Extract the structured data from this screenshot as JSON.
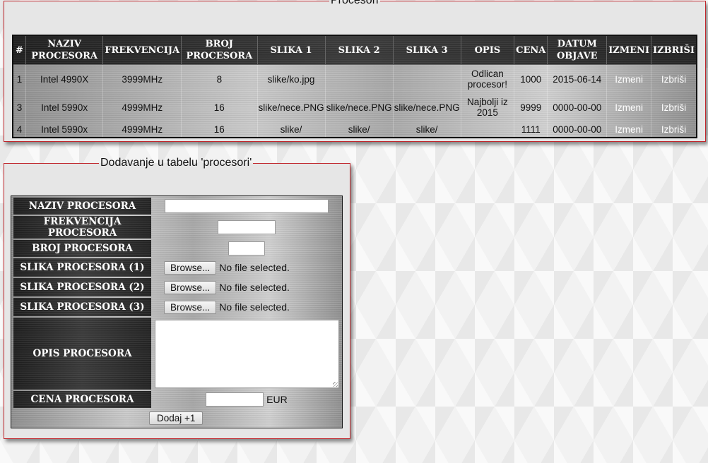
{
  "procesori_section": {
    "legend": "Procesori",
    "headers": [
      "#",
      "NAZIV PROCESORA",
      "FREKVENCIJA",
      "BROJ PROCESORA",
      "SLIKA 1",
      "SLIKA 2",
      "SLIKA 3",
      "OPIS",
      "CENA",
      "DATUM OBJAVE",
      "IZMENI",
      "IZBRIŠI"
    ],
    "rows": [
      {
        "id": "1",
        "naziv": "Intel 4990X",
        "frekvencija": "3999MHz",
        "broj": "8",
        "slika1": "slike/ko.jpg",
        "slika2": "",
        "slika3": "",
        "opis": "Odlican procesor!",
        "cena": "1000",
        "datum": "2015-06-14",
        "izmeni": "Izmeni",
        "izbrisi": "Izbriši"
      },
      {
        "id": "3",
        "naziv": "Intel 5990x",
        "frekvencija": "4999MHz",
        "broj": "16",
        "slika1": "slike/nece.PNG",
        "slika2": "slike/nece.PNG",
        "slika3": "slike/nece.PNG",
        "opis": "Najbolji iz 2015",
        "cena": "9999",
        "datum": "0000-00-00",
        "izmeni": "Izmeni",
        "izbrisi": "Izbriši"
      },
      {
        "id": "4",
        "naziv": "Intel 5990x",
        "frekvencija": "4999MHz",
        "broj": "16",
        "slika1": "slike/",
        "slika2": "slike/",
        "slika3": "slike/",
        "opis": "",
        "cena": "1111",
        "datum": "0000-00-00",
        "izmeni": "Izmeni",
        "izbrisi": "Izbriši"
      }
    ]
  },
  "form": {
    "legend": "Dodavanje u tabelu 'procesori'",
    "naziv_label": "NAZIV PROCESORA",
    "frekvencija_label": "FREKVENCIJA PROCESORA",
    "broj_label": "BROJ PROCESORA",
    "slika1_label": "SLIKA PROCESORA (1)",
    "slika2_label": "SLIKA PROCESORA (2)",
    "slika3_label": "SLIKA PROCESORA (3)",
    "opis_label": "OPIS PROCESORA",
    "cena_label": "CENA PROCESORA",
    "browse_label": "Browse...",
    "no_file_text": "No file selected.",
    "currency": "EUR",
    "submit_label": "Dodaj +1"
  }
}
